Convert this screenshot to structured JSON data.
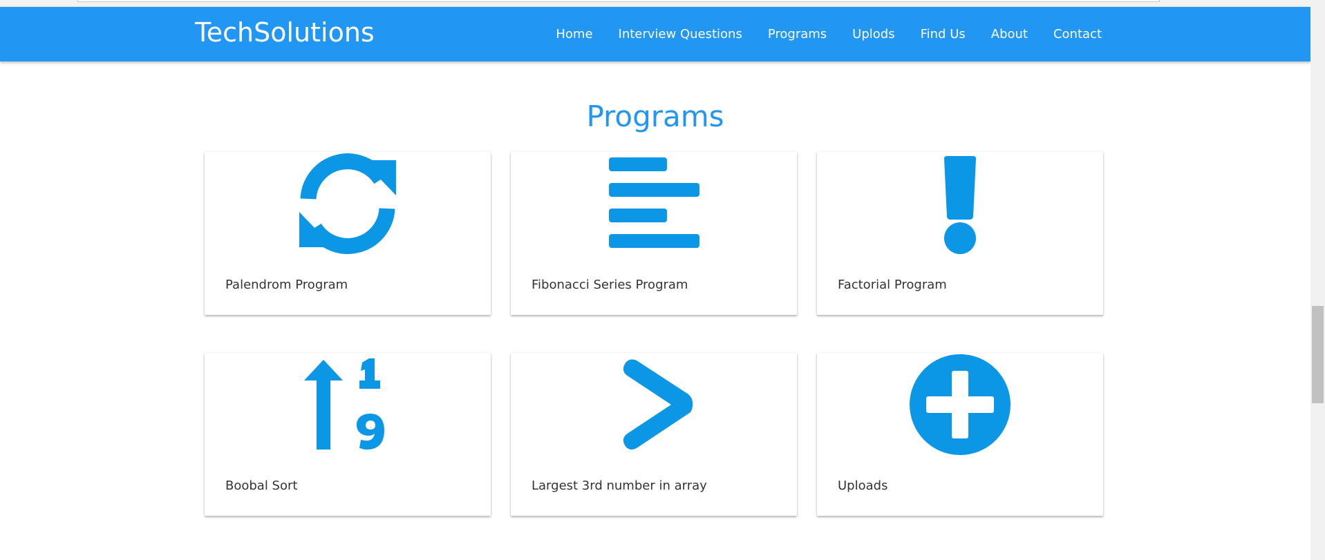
{
  "header": {
    "brand": "TechSolutions",
    "nav": [
      "Home",
      "Interview Questions",
      "Programs",
      "Uplods",
      "Find Us",
      "About",
      "Contact"
    ]
  },
  "main": {
    "title": "Programs",
    "cards": [
      {
        "label": "Palendrom Program",
        "icon": "sync-icon"
      },
      {
        "label": "Fibonacci Series Program",
        "icon": "align-left-icon"
      },
      {
        "label": "Factorial Program",
        "icon": "exclamation-icon"
      },
      {
        "label": "Boobal Sort",
        "icon": "sort-numeric-icon"
      },
      {
        "label": "Largest 3rd number in array",
        "icon": "greater-than-icon"
      },
      {
        "label": "Uploads",
        "icon": "plus-circle-icon"
      }
    ]
  },
  "colors": {
    "primary": "#2196f3",
    "icon": "#0b97e6",
    "text": "#333333"
  }
}
